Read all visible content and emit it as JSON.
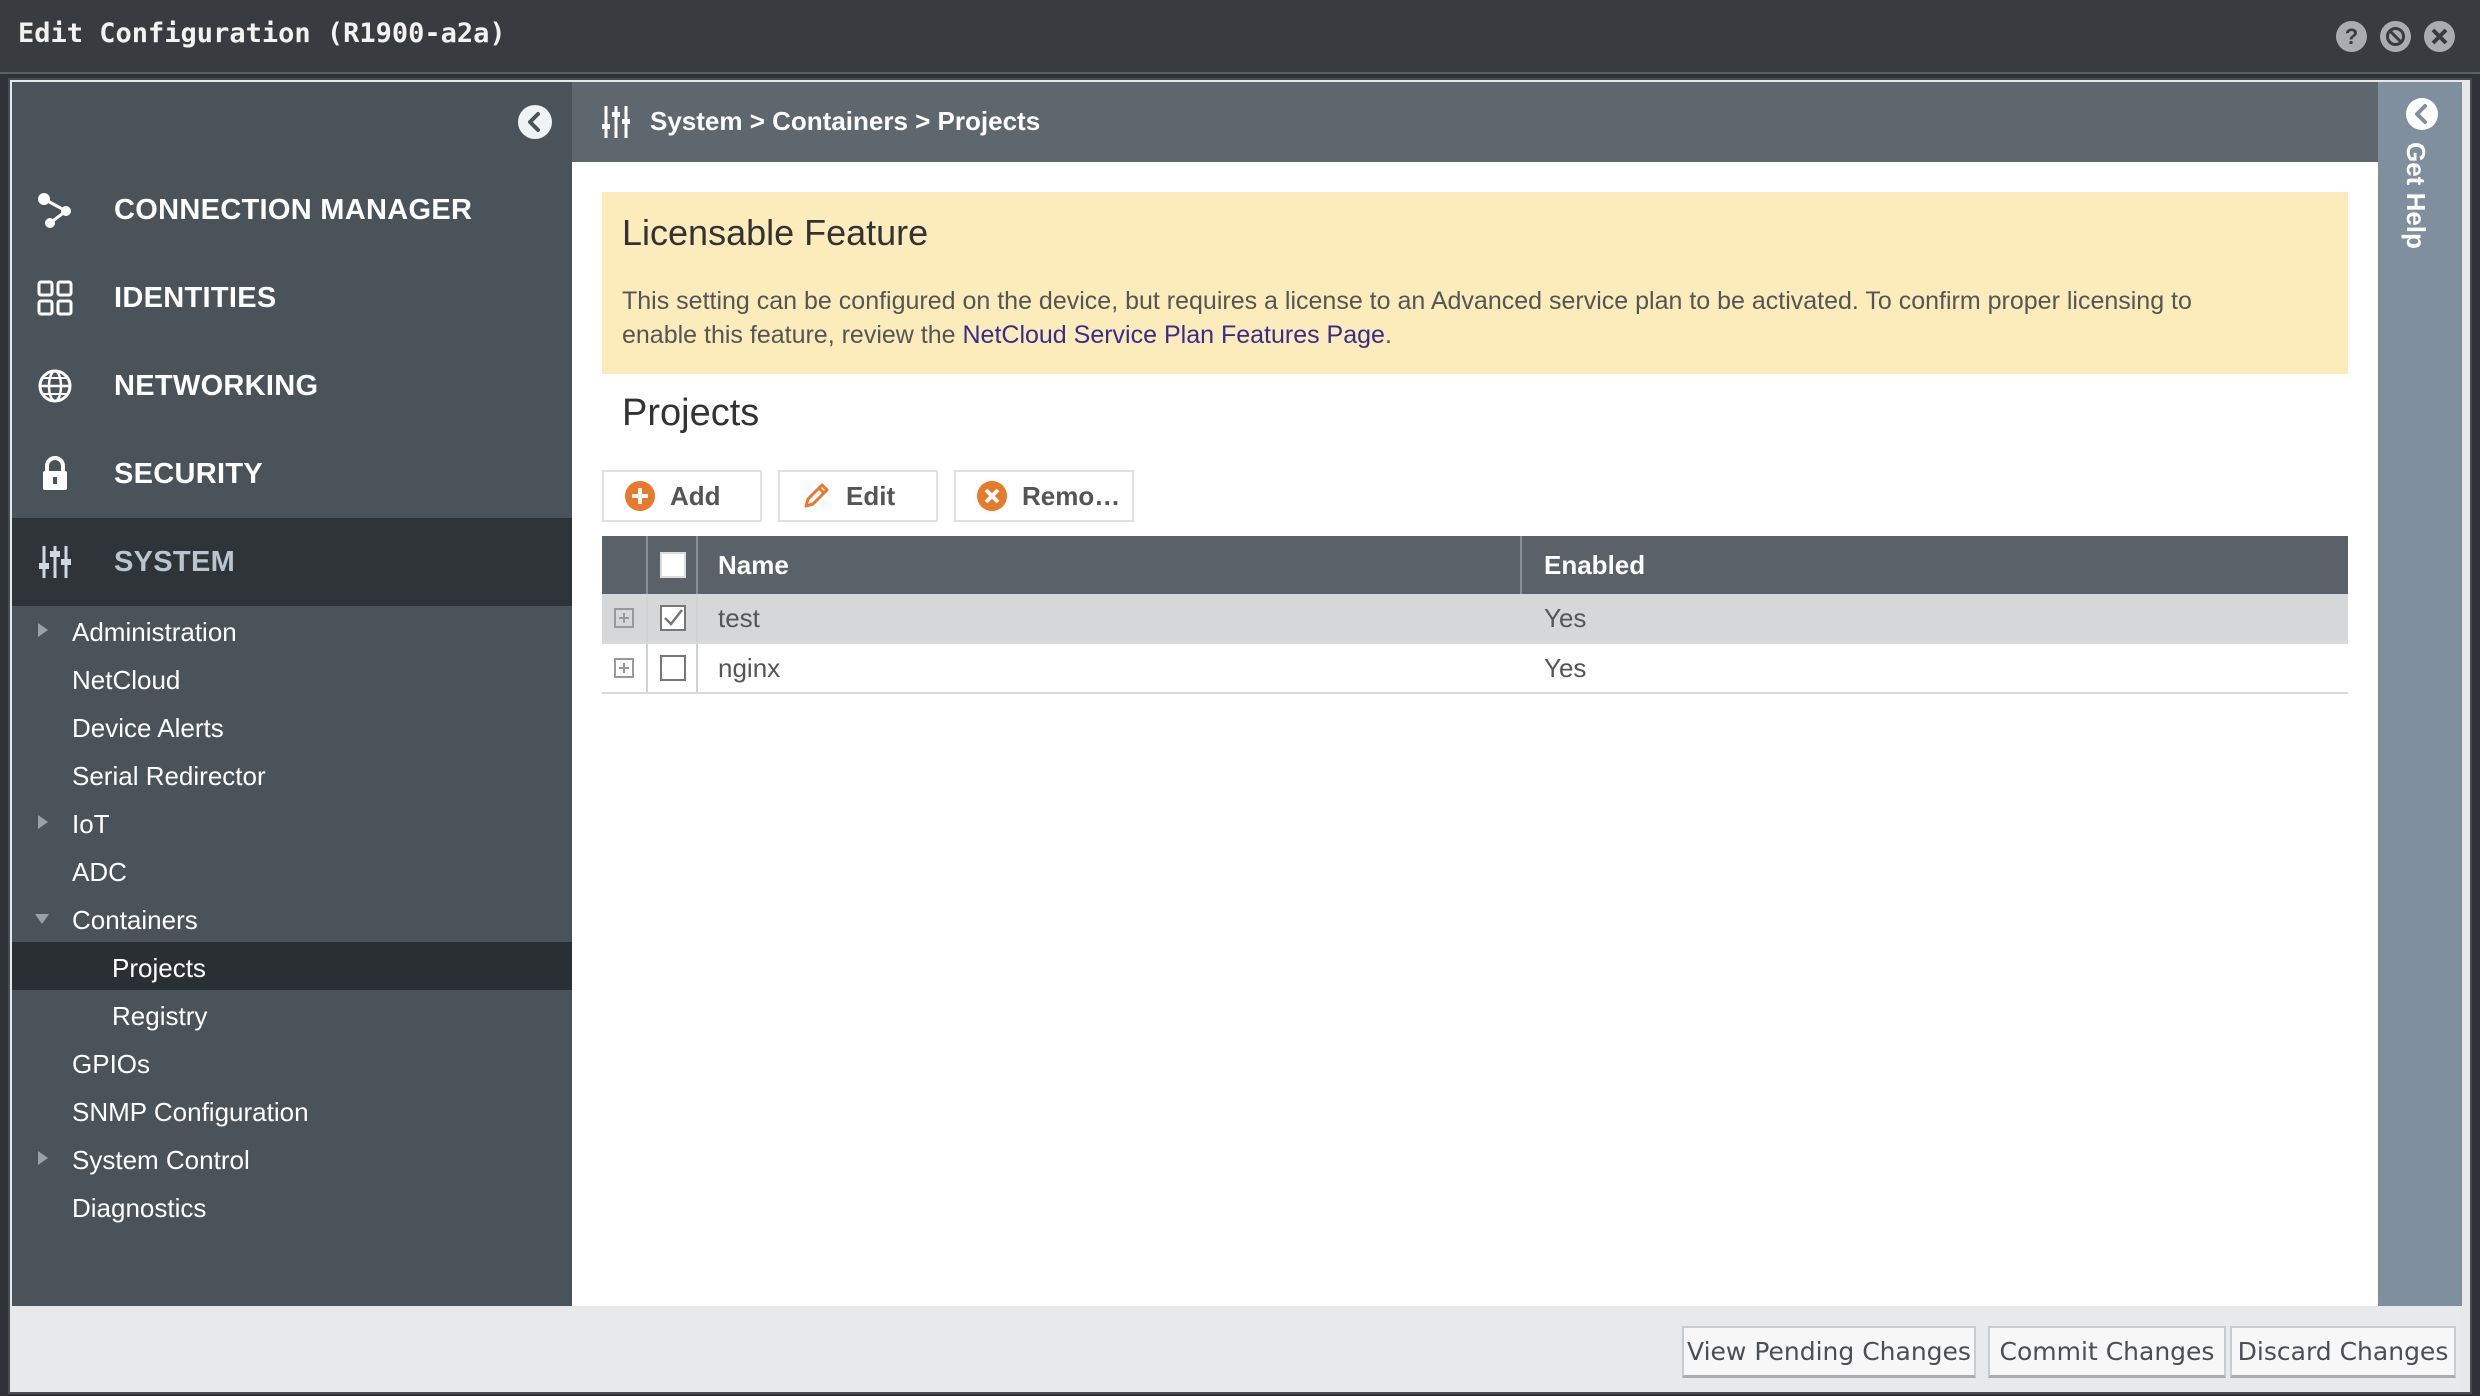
{
  "window": {
    "title": "Edit Configuration (R1900-a2a)",
    "controls": [
      "help-icon",
      "minimize-icon",
      "close-icon"
    ]
  },
  "sidebar": {
    "main_items": [
      {
        "label": "CONNECTION MANAGER",
        "icon": "connection-icon"
      },
      {
        "label": "IDENTITIES",
        "icon": "identities-icon"
      },
      {
        "label": "NETWORKING",
        "icon": "globe-icon"
      },
      {
        "label": "SECURITY",
        "icon": "lock-icon"
      },
      {
        "label": "SYSTEM",
        "icon": "sliders-icon",
        "active": true
      }
    ],
    "sub_items": [
      {
        "label": "Administration",
        "arrow": "right"
      },
      {
        "label": "NetCloud"
      },
      {
        "label": "Device Alerts"
      },
      {
        "label": "Serial Redirector"
      },
      {
        "label": "IoT",
        "arrow": "right"
      },
      {
        "label": "ADC"
      },
      {
        "label": "Containers",
        "arrow": "down"
      },
      {
        "label": "Projects",
        "level": 2,
        "active": true
      },
      {
        "label": "Registry",
        "level": 2
      },
      {
        "label": "GPIOs"
      },
      {
        "label": "SNMP Configuration"
      },
      {
        "label": "System Control",
        "arrow": "right"
      },
      {
        "label": "Diagnostics"
      }
    ]
  },
  "breadcrumb": "System > Containers > Projects",
  "notice": {
    "title": "Licensable Feature",
    "text_line1": "This setting can be configured on the device, but requires a license to an Advanced service plan to be activated. To confirm proper licensing to",
    "text_line2_prefix": "enable this feature, review the ",
    "link": "NetCloud Service Plan Features Page",
    "text_line2_suffix": "."
  },
  "section_title": "Projects",
  "toolbar": {
    "add_label": "Add",
    "edit_label": "Edit",
    "remove_label": "Remo…"
  },
  "table": {
    "columns": [
      "Name",
      "Enabled"
    ],
    "rows": [
      {
        "name": "test",
        "enabled": "Yes",
        "checked": true
      },
      {
        "name": "nginx",
        "enabled": "Yes",
        "checked": false
      }
    ]
  },
  "help_rail": {
    "label": "Get Help"
  },
  "footer": {
    "view_pending": "View Pending Changes",
    "commit": "Commit Changes",
    "discard": "Discard Changes"
  },
  "colors": {
    "accent_orange": "#e8782a",
    "sidebar_bg": "#4b535a",
    "notice_bg": "#fcecbb",
    "link": "#3a2c8a"
  }
}
